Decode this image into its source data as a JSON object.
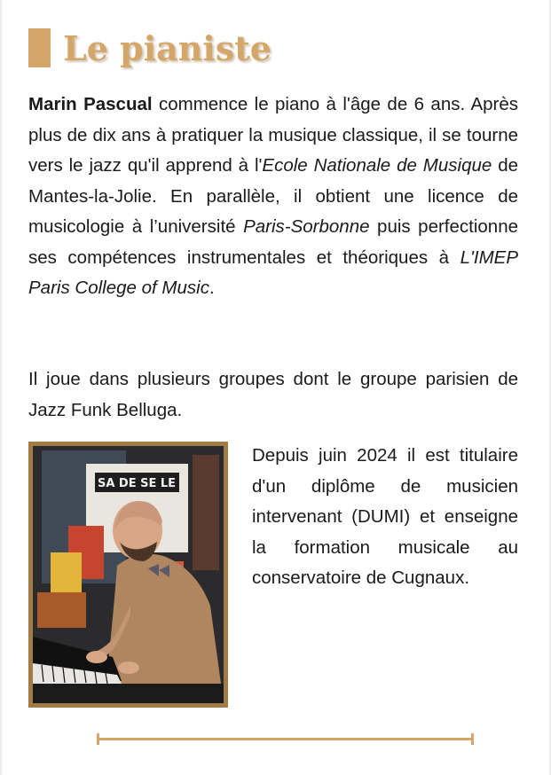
{
  "title": "Le pianiste",
  "paragraph1": {
    "name": "Marin Pascual",
    "t1": " commence le piano à l'âge de 6 ans. Après plus de dix ans à pratiquer la musique classique, il se tourne vers le jazz qu'il apprend à l'",
    "school": "Ecole Nationale de Musique",
    "t2": " de Mantes-la-Jolie. En parallèle, il obtient une licence de musicologie à l’université ",
    "university": "Paris-Sorbonne",
    "t3": " puis perfectionne ses compétences instrumentales et théoriques à ",
    "college": "L'IMEP Paris College of Music",
    "t4": "."
  },
  "paragraph2": "Il joue dans plusieurs groupes dont le groupe parisien de Jazz Funk Belluga.",
  "paragraph3": "Depuis juin 2024 il est titulaire d'un diplôme de musicien intervenant (DUMI) et enseigne la formation musicale au conservatoire de Cugnaux.",
  "photo_sign_text": "SA DE SE LE",
  "colors": {
    "accent": "#d4a66a",
    "frame": "#a27c44",
    "text": "#1a1a1a"
  }
}
